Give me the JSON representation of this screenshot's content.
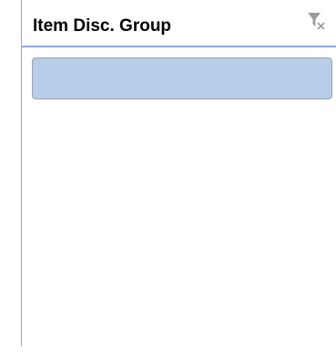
{
  "slicer": {
    "title": "Item Disc. Group",
    "clear_filter_icon": "clear-filter-icon",
    "items": [
      {
        "label": ""
      }
    ]
  },
  "colors": {
    "border": "#8eaadb",
    "item_fill": "#b7cde8",
    "item_border": "#9aa3ad",
    "icon": "#9b9b9b"
  }
}
